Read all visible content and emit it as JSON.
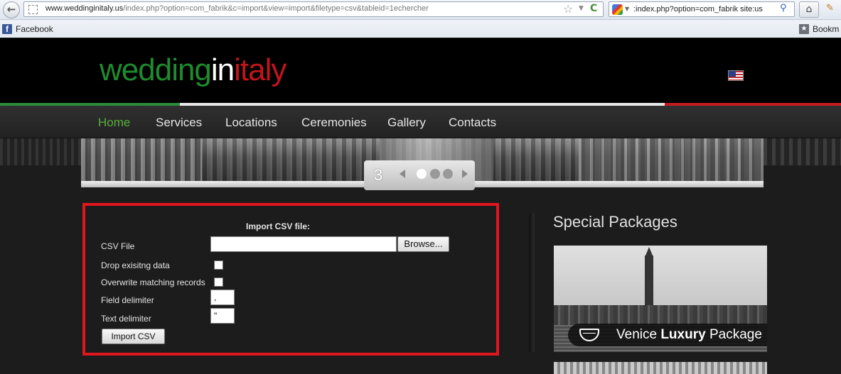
{
  "browser": {
    "url_host": "www.weddinginitaly.us",
    "url_path": "/index.php?option=com_fabrik&c=import&view=import&filetype=csv&tableid=1echercher",
    "search_query": ":index.php?option=com_fabrik site:us",
    "bookmarks": [
      {
        "label": "Facebook",
        "icon": "facebook-icon"
      },
      {
        "label": "Bookm",
        "icon": "bookmarks-icon"
      }
    ]
  },
  "site": {
    "logo": {
      "part1": "wedding",
      "part2": "in",
      "part3": "italy"
    },
    "colors": {
      "green": "#1f8a2e",
      "white": "#ffffff",
      "red": "#c2141b",
      "nav_active": "#58b03a",
      "panel_border": "#e2161d"
    },
    "nav": [
      {
        "label": "Home",
        "active": true
      },
      {
        "label": "Services"
      },
      {
        "label": "Locations"
      },
      {
        "label": "Ceremonies"
      },
      {
        "label": "Gallery"
      },
      {
        "label": "Contacts"
      }
    ],
    "slider": {
      "current_slide": "3",
      "dots": 3,
      "active_dot": 1
    }
  },
  "import_form": {
    "title": "Import CSV file:",
    "csv_file_label": "CSV File",
    "browse_label": "Browse...",
    "drop_label": "Drop exisitng data",
    "overwrite_label": "Overwrite matching records",
    "field_delim_label": "Field delimiter",
    "field_delim_value": ",",
    "text_delim_label": "Text delimiter",
    "text_delim_value": "\"",
    "submit_label": "Import CSV"
  },
  "sidebar": {
    "title": "Special Packages",
    "package": {
      "name_regular": "Venice ",
      "name_bold": "Luxury",
      "name_suffix": " Package"
    }
  }
}
